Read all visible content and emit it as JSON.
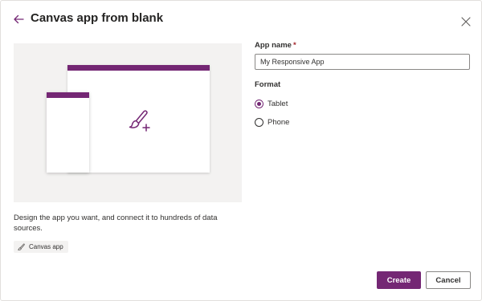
{
  "header": {
    "title": "Canvas app from blank",
    "back_icon": "arrow-left-icon",
    "close_icon": "close-icon"
  },
  "illustration": {
    "icon": "paintbrush-add-icon",
    "description": "Design the app you want, and connect it to hundreds of data sources.",
    "tag_label": "Canvas app",
    "tag_icon": "brush-icon"
  },
  "form": {
    "app_name_label": "App name",
    "required_marker": "*",
    "app_name_value": "My Responsive App",
    "format_label": "Format",
    "format_options": [
      {
        "label": "Tablet",
        "selected": true
      },
      {
        "label": "Phone",
        "selected": false
      }
    ]
  },
  "actions": {
    "create_label": "Create",
    "cancel_label": "Cancel"
  },
  "colors": {
    "accent": "#742774",
    "illustration_bg": "#f3f2f1",
    "required": "#a4262c"
  }
}
